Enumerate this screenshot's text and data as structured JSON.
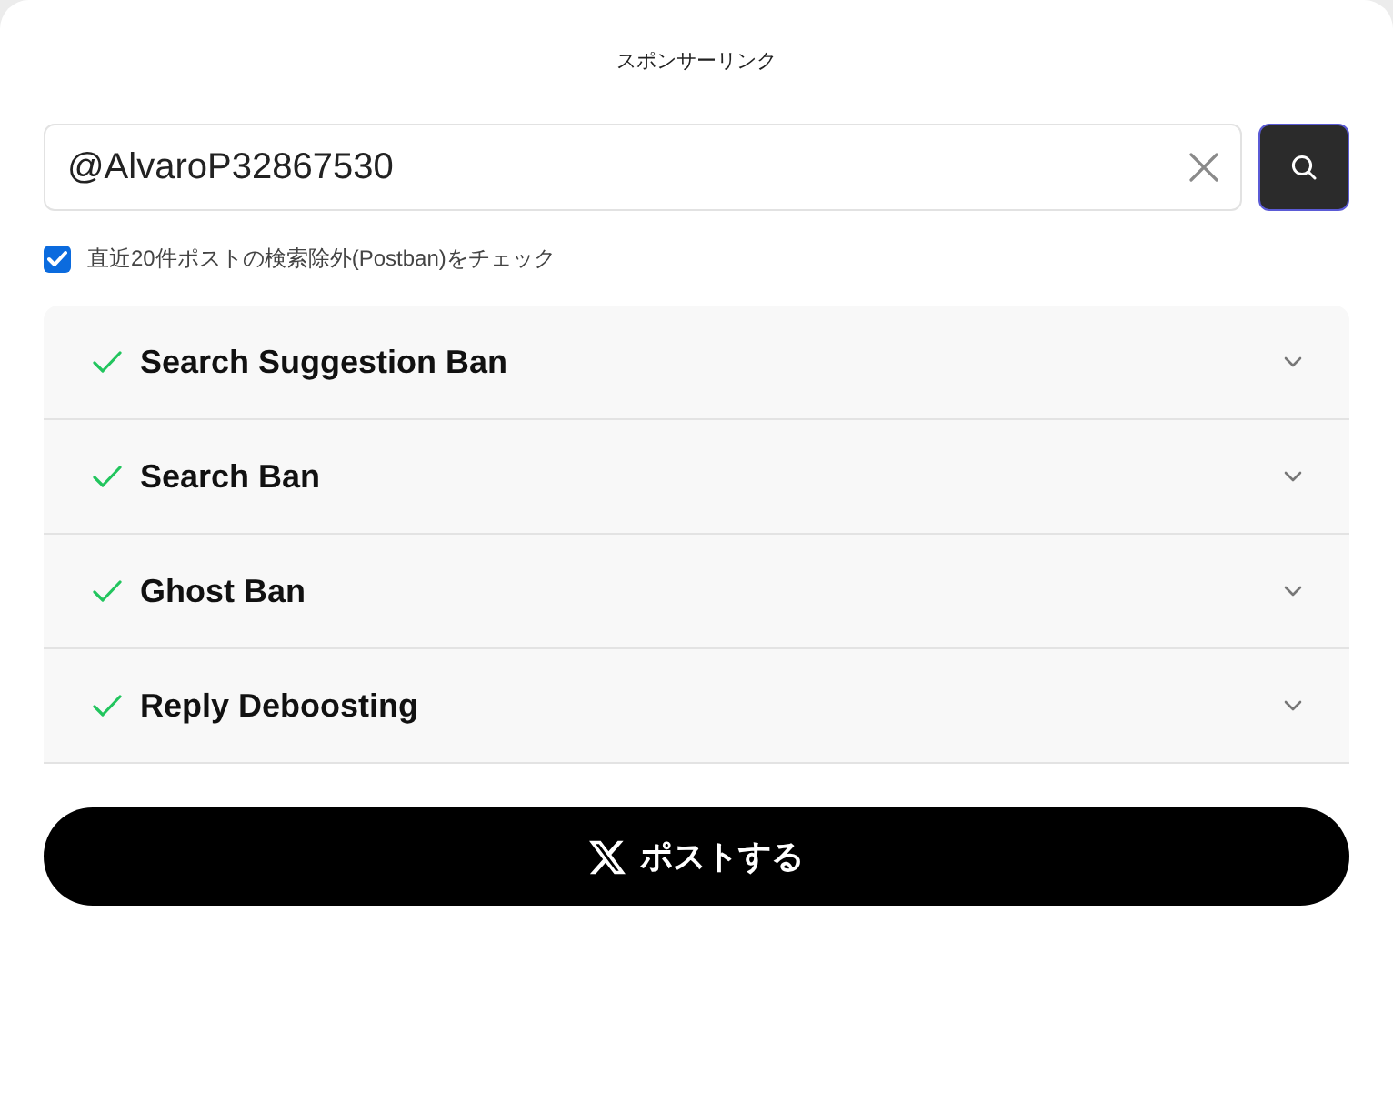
{
  "sponsor_label": "スポンサーリンク",
  "search": {
    "value": "@AlvaroP32867530"
  },
  "postban_check": {
    "label": "直近20件ポストの検索除外(Postban)をチェック",
    "checked": true
  },
  "checks": [
    {
      "title": "Search Suggestion Ban",
      "passed": true,
      "expanded": false
    },
    {
      "title": "Search Ban",
      "passed": true,
      "expanded": false
    },
    {
      "title": "Ghost Ban",
      "passed": true,
      "expanded": false
    },
    {
      "title": "Reply Deboosting",
      "passed": true,
      "expanded": false
    }
  ],
  "post_button": {
    "label": "ポストする"
  }
}
